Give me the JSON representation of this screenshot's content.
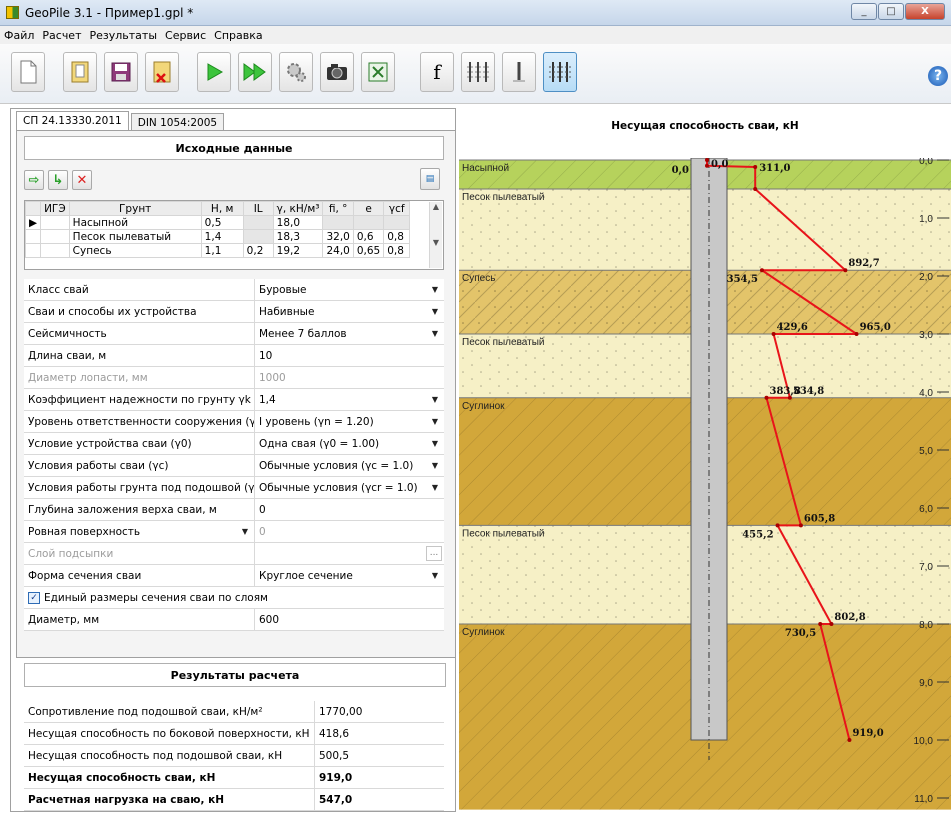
{
  "window": {
    "title": "GeoPile 3.1  -  Пример1.gpl *",
    "buttons": [
      "_",
      "□",
      "X"
    ]
  },
  "menu": [
    "Файл",
    "Расчет",
    "Результаты",
    "Сервис",
    "Справка"
  ],
  "toolbar": {
    "icons": [
      "new-file-icon",
      "open-file-icon",
      "save-icon",
      "close-file-icon",
      "run-icon",
      "run-all-icon",
      "settings-icon",
      "camera-icon",
      "excel-icon",
      "function-icon",
      "pile-group-icon",
      "single-pile-icon",
      "pile-field-icon",
      "help-icon"
    ],
    "f_label": "f",
    "help_label": "?"
  },
  "tabs": [
    "СП 24.13330.2011",
    "DIN 1054:2005"
  ],
  "input": {
    "heading": "Исходные данные",
    "table_headers": [
      "ИГЭ",
      "Грунт",
      "H, м",
      "IL",
      "γ, кН/м³",
      "fi, °",
      "e",
      "γcf"
    ],
    "table_rows": [
      [
        "Насыпной",
        "0,5",
        "",
        "18,0",
        "",
        "",
        ""
      ],
      [
        "Песок пылеватый",
        "1,4",
        "",
        "18,3",
        "32,0",
        "0,6",
        "0,8"
      ],
      [
        "Супесь",
        "1,1",
        "0,2",
        "19,2",
        "24,0",
        "0,65",
        "0,8"
      ]
    ],
    "props": [
      {
        "label": "Класс свай",
        "value": "Буровые",
        "dropdown": true
      },
      {
        "label": "Сваи и способы их устройства",
        "value": "Набивные",
        "dropdown": true
      },
      {
        "label": "Сейсмичность",
        "value": "Менее 7 баллов",
        "dropdown": true
      },
      {
        "label": "Длина сваи, м",
        "value": "10"
      },
      {
        "label": "Диаметр лопасти, мм",
        "value": "1000",
        "disabled": true
      },
      {
        "label": "Коэффициент надежности по грунту γk",
        "value": "1,4",
        "dropdown": true
      },
      {
        "label": "Уровень ответственности сооружения (γn)",
        "value": "I  уровень (γn = 1.20)",
        "dropdown": true
      },
      {
        "label": "Условие устройства сваи (γ0)",
        "value": "Одна свая (γ0 = 1.00)",
        "dropdown": true
      },
      {
        "label": "Условия работы сваи (γc)",
        "value": "Обычные условия (γc = 1.0)",
        "dropdown": true
      },
      {
        "label": "Условия работы грунта под подошвой (γcr)",
        "value": "Обычные условия  (γcr = 1.0)",
        "dropdown": true
      },
      {
        "label": "Глубина заложения верха сваи, м",
        "value": "0"
      },
      {
        "label": "Ровная поверхность",
        "value": "0",
        "label_dropdown": true,
        "value_disabled": true
      },
      {
        "label": "Слой подсыпки",
        "value": "",
        "disabled": true,
        "ellipsis": "..."
      },
      {
        "label": "Форма сечения сваи",
        "value": "Круглое сечение",
        "dropdown": true
      },
      {
        "label": "Единый размеры сечения сваи по слоям",
        "checkbox": true,
        "checked": true
      },
      {
        "label": "Диаметр, мм",
        "value": "600"
      }
    ]
  },
  "results": {
    "heading": "Результаты расчета",
    "rows": [
      {
        "label": "Сопротивление под подошвой сваи, кН/м²",
        "value": "1770,00"
      },
      {
        "label": "Несущая способность по боковой поверхности, кН",
        "value": "418,6"
      },
      {
        "label": "Несущая способность под подошвой сваи, кН",
        "value": "500,5"
      },
      {
        "label": "Несущая способность сваи, кН",
        "value": "919,0",
        "bold": true
      },
      {
        "label": "Расчетная нагрузка на сваю, кН",
        "value": "547,0",
        "bold": true
      }
    ]
  },
  "chart_data": {
    "type": "line",
    "title": "Несущая способность сваи, кН",
    "depth_unit": "м",
    "ylim": [
      0,
      11
    ],
    "y_ticks": [
      "0,0",
      "1,0",
      "2,0",
      "3,0",
      "4,0",
      "5,0",
      "6,0",
      "7,0",
      "8,0",
      "9,0",
      "10,0",
      "11,0"
    ],
    "layers": [
      {
        "name": "Насыпной",
        "top": 0,
        "bottom": 0.5,
        "color": "#b6d25c",
        "hatch": "diag"
      },
      {
        "name": "Песок пылеватый",
        "top": 0.5,
        "bottom": 1.9,
        "color": "#f6f0c6",
        "hatch": "dots"
      },
      {
        "name": "Супесь",
        "top": 1.9,
        "bottom": 3.0,
        "color": "#e3c46a",
        "hatch": "diag-dots"
      },
      {
        "name": "Песок пылеватый",
        "top": 3.0,
        "bottom": 4.1,
        "color": "#f6f0c6",
        "hatch": "dots"
      },
      {
        "name": "Суглинок",
        "top": 4.1,
        "bottom": 6.3,
        "color": "#d2a73a",
        "hatch": "diag"
      },
      {
        "name": "Песок пылеватый",
        "top": 6.3,
        "bottom": 8.0,
        "color": "#f6f0c6",
        "hatch": "dots"
      },
      {
        "name": "Суглинок",
        "top": 8.0,
        "bottom": 11.2,
        "color": "#d2a73a",
        "hatch": "diag"
      }
    ],
    "pile_length": 10,
    "series": [
      {
        "points": [
          {
            "v": 0,
            "d": 0
          },
          {
            "v": 0,
            "d": 0.1
          },
          {
            "v": 311.0,
            "d": 0.12
          },
          {
            "v": 311.0,
            "d": 0.5
          },
          {
            "v": 892.7,
            "d": 1.9
          },
          {
            "v": 354.5,
            "d": 1.9
          },
          {
            "v": 965.0,
            "d": 3.0
          },
          {
            "v": 429.6,
            "d": 3.0
          },
          {
            "v": 534.8,
            "d": 4.1
          },
          {
            "v": 383.8,
            "d": 4.1
          },
          {
            "v": 605.8,
            "d": 6.3
          },
          {
            "v": 455.2,
            "d": 6.3
          },
          {
            "v": 802.8,
            "d": 8.0
          },
          {
            "v": 730.5,
            "d": 8.0
          },
          {
            "v": 919.0,
            "d": 10.0
          }
        ],
        "point_labels": [
          {
            "text": "0,0",
            "d": 0.05,
            "v": 0,
            "side": "left"
          },
          {
            "text": "0,0",
            "d": 0.05,
            "v": 0,
            "side": "right"
          },
          {
            "text": "311,0",
            "d": 0.12,
            "v": 311.0,
            "side": "right"
          },
          {
            "text": "892,7",
            "d": 1.9,
            "v": 892.7,
            "side": "above"
          },
          {
            "text": "354,5",
            "d": 1.9,
            "v": 354.5,
            "side": "below"
          },
          {
            "text": "965,0",
            "d": 3.0,
            "v": 965.0,
            "side": "above"
          },
          {
            "text": "429,6",
            "d": 3.0,
            "v": 429.6,
            "side": "above"
          },
          {
            "text": "534,8",
            "d": 4.1,
            "v": 534.8,
            "side": "above"
          },
          {
            "text": "383,8",
            "d": 4.1,
            "v": 383.8,
            "side": "above"
          },
          {
            "text": "605,8",
            "d": 6.3,
            "v": 605.8,
            "side": "above"
          },
          {
            "text": "455,2",
            "d": 6.3,
            "v": 455.2,
            "side": "below"
          },
          {
            "text": "802,8",
            "d": 8.0,
            "v": 802.8,
            "side": "above"
          },
          {
            "text": "730,5",
            "d": 8.0,
            "v": 730.5,
            "side": "below"
          },
          {
            "text": "919,0",
            "d": 10.0,
            "v": 919.0,
            "side": "above"
          }
        ]
      }
    ],
    "line_color": "#e8141a"
  }
}
